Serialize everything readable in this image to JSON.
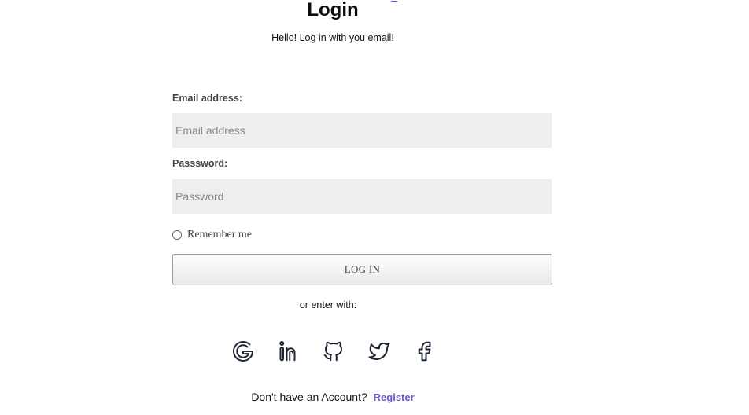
{
  "page": {
    "title": "Login",
    "subtitle": "Hello! Log in with you email!"
  },
  "form": {
    "email_label": "Email address:",
    "email_placeholder": "Email address",
    "email_value": "",
    "password_label": "Passsword:",
    "password_placeholder": "Password",
    "password_value": "",
    "remember_label": "Remember me",
    "remember_checked": false,
    "submit_label": "LOG IN"
  },
  "social": {
    "prompt": "or enter with:",
    "providers": [
      {
        "name": "google",
        "icon": "google-icon"
      },
      {
        "name": "linkedin",
        "icon": "linkedin-icon"
      },
      {
        "name": "github",
        "icon": "github-icon"
      },
      {
        "name": "twitter",
        "icon": "twitter-icon"
      },
      {
        "name": "facebook",
        "icon": "facebook-icon"
      }
    ]
  },
  "footer": {
    "prompt": "Don't have an Account?",
    "register_label": "Register"
  },
  "colors": {
    "link": "#6a5acd",
    "icon": "#1e2535",
    "field_bg": "#eeeeee"
  }
}
